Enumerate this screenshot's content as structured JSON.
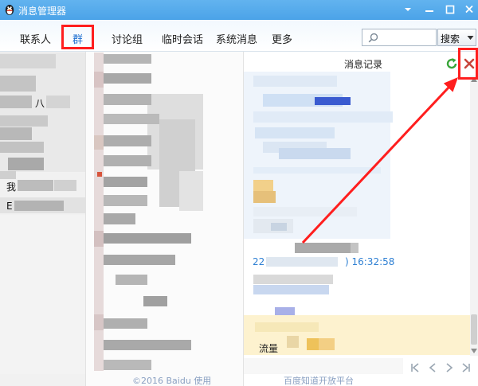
{
  "window": {
    "title": "消息管理器",
    "icon": "qq-penguin-icon",
    "controls": [
      "dropdown-icon",
      "minimize-icon",
      "maximize-icon",
      "close-icon"
    ]
  },
  "tabs": [
    {
      "label": "联系人",
      "active": false
    },
    {
      "label": "群",
      "active": true
    },
    {
      "label": "讨论组",
      "active": false
    },
    {
      "label": "临时会话",
      "active": false
    },
    {
      "label": "系统消息",
      "active": false
    },
    {
      "label": "更多",
      "active": false
    }
  ],
  "search": {
    "icon": "search-icon",
    "button_label": "搜索",
    "dropdown_icon": "chevron-down-icon"
  },
  "contact_list": {
    "fragments": [
      "八",
      "我",
      "E"
    ]
  },
  "message_pane": {
    "title": "消息记录",
    "toolbar_icons": [
      "refresh-icon",
      "delete-icon"
    ],
    "sender_prefix": "22",
    "timestamp": ") 16:32:58",
    "highlighted_message": "流量",
    "pagination_icons": [
      "first-page-icon",
      "prev-page-icon",
      "next-page-icon",
      "last-page-icon"
    ]
  },
  "watermark": {
    "copyright": "©2016 Baidu 使用",
    "platform": "百度知道开放平台"
  },
  "colors": {
    "title_bar": "#4ba3e8",
    "active_tab": "#1d6fd0",
    "annotation": "#ff1e1e",
    "link": "#2f80d3",
    "highlight": "#fdf2cf"
  }
}
